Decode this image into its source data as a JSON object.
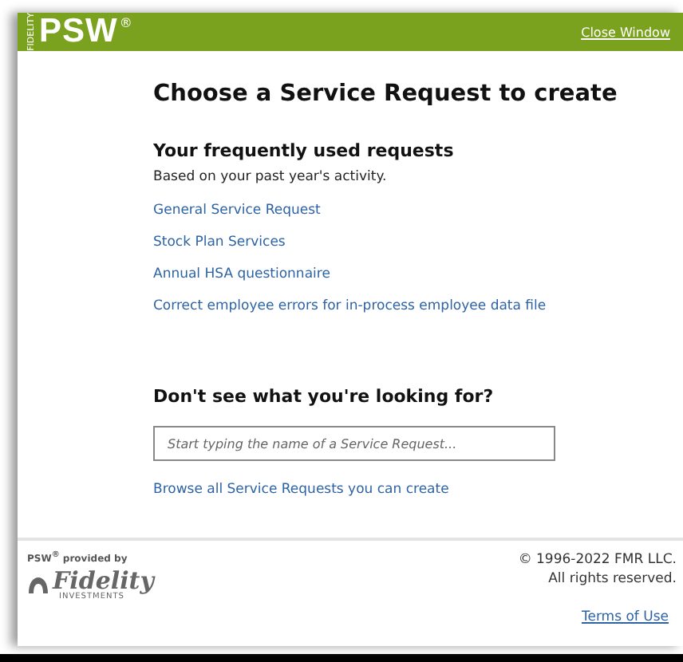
{
  "header": {
    "brand_small": "FIDELITY",
    "brand": "PSW",
    "brand_mark": "®",
    "close_link": "Close Window"
  },
  "title": "Choose a Service Request to create",
  "frequent": {
    "heading": "Your frequently used requests",
    "subtitle": "Based on your past year's activity.",
    "links": [
      "General Service Request",
      "Stock Plan Services",
      "Annual HSA questionnaire",
      "Correct employee errors for in-process employee data file"
    ]
  },
  "search": {
    "heading": "Don't see what you're looking for?",
    "placeholder": "Start typing the name of a Service Request...",
    "browse_link": "Browse all Service Requests you can create"
  },
  "footer": {
    "provided_by": "PSW$^{®}$ provided by",
    "logo_text": "Fidelity",
    "logo_subtext": "INVESTMENTS",
    "copyright": "© 1996-2022 FMR LLC.",
    "rights": "All rights reserved.",
    "terms_link": "Terms of Use"
  }
}
